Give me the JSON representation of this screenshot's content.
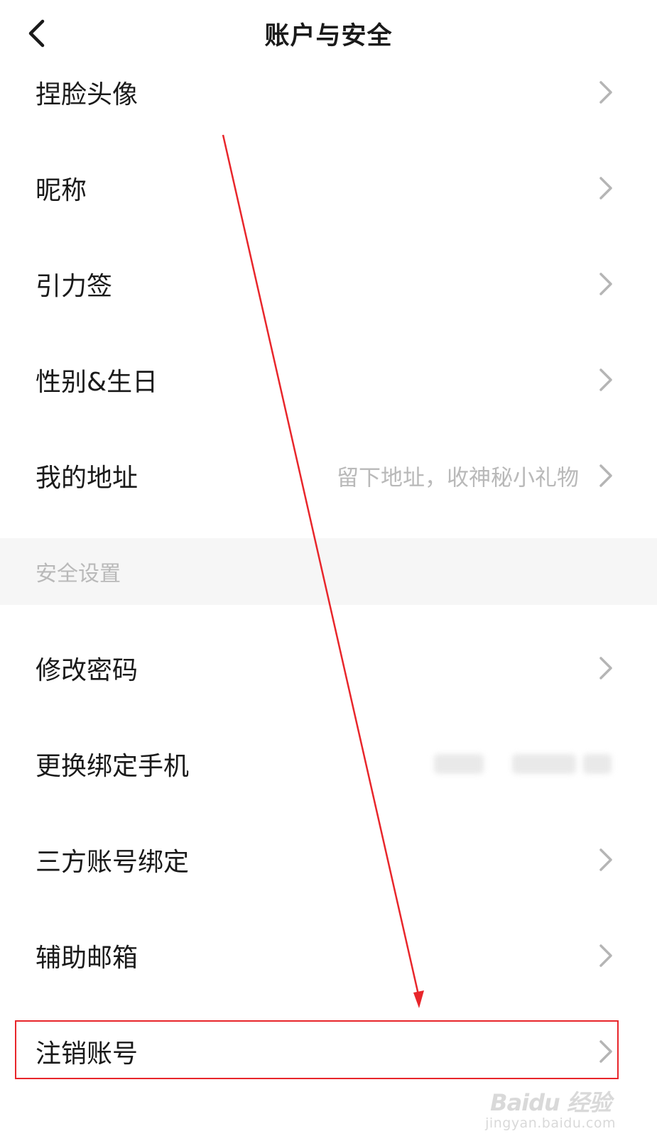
{
  "header": {
    "title": "账户与安全",
    "back_icon": "chevron-left-icon"
  },
  "profile_items": [
    {
      "label": "捏脸头像",
      "value": ""
    },
    {
      "label": "昵称",
      "value": ""
    },
    {
      "label": "引力签",
      "value": ""
    },
    {
      "label": "性别&生日",
      "value": ""
    },
    {
      "label": "我的地址",
      "value": "留下地址，收神秘小礼物"
    }
  ],
  "security_section": {
    "title": "安全设置",
    "items": [
      {
        "label": "修改密码",
        "value": ""
      },
      {
        "label": "更换绑定手机",
        "value": ""
      },
      {
        "label": "三方账号绑定",
        "value": ""
      },
      {
        "label": "辅助邮箱",
        "value": ""
      },
      {
        "label": "注销账号",
        "value": ""
      }
    ]
  },
  "annotation": {
    "highlight_color": "#e8262b"
  },
  "watermark": {
    "main": "Baidu 经验",
    "sub": "jingyan.baidu.com"
  },
  "colors": {
    "text": "#1a1a1a",
    "secondary_text": "#b9b9b9",
    "section_bg": "#f6f6f6"
  }
}
